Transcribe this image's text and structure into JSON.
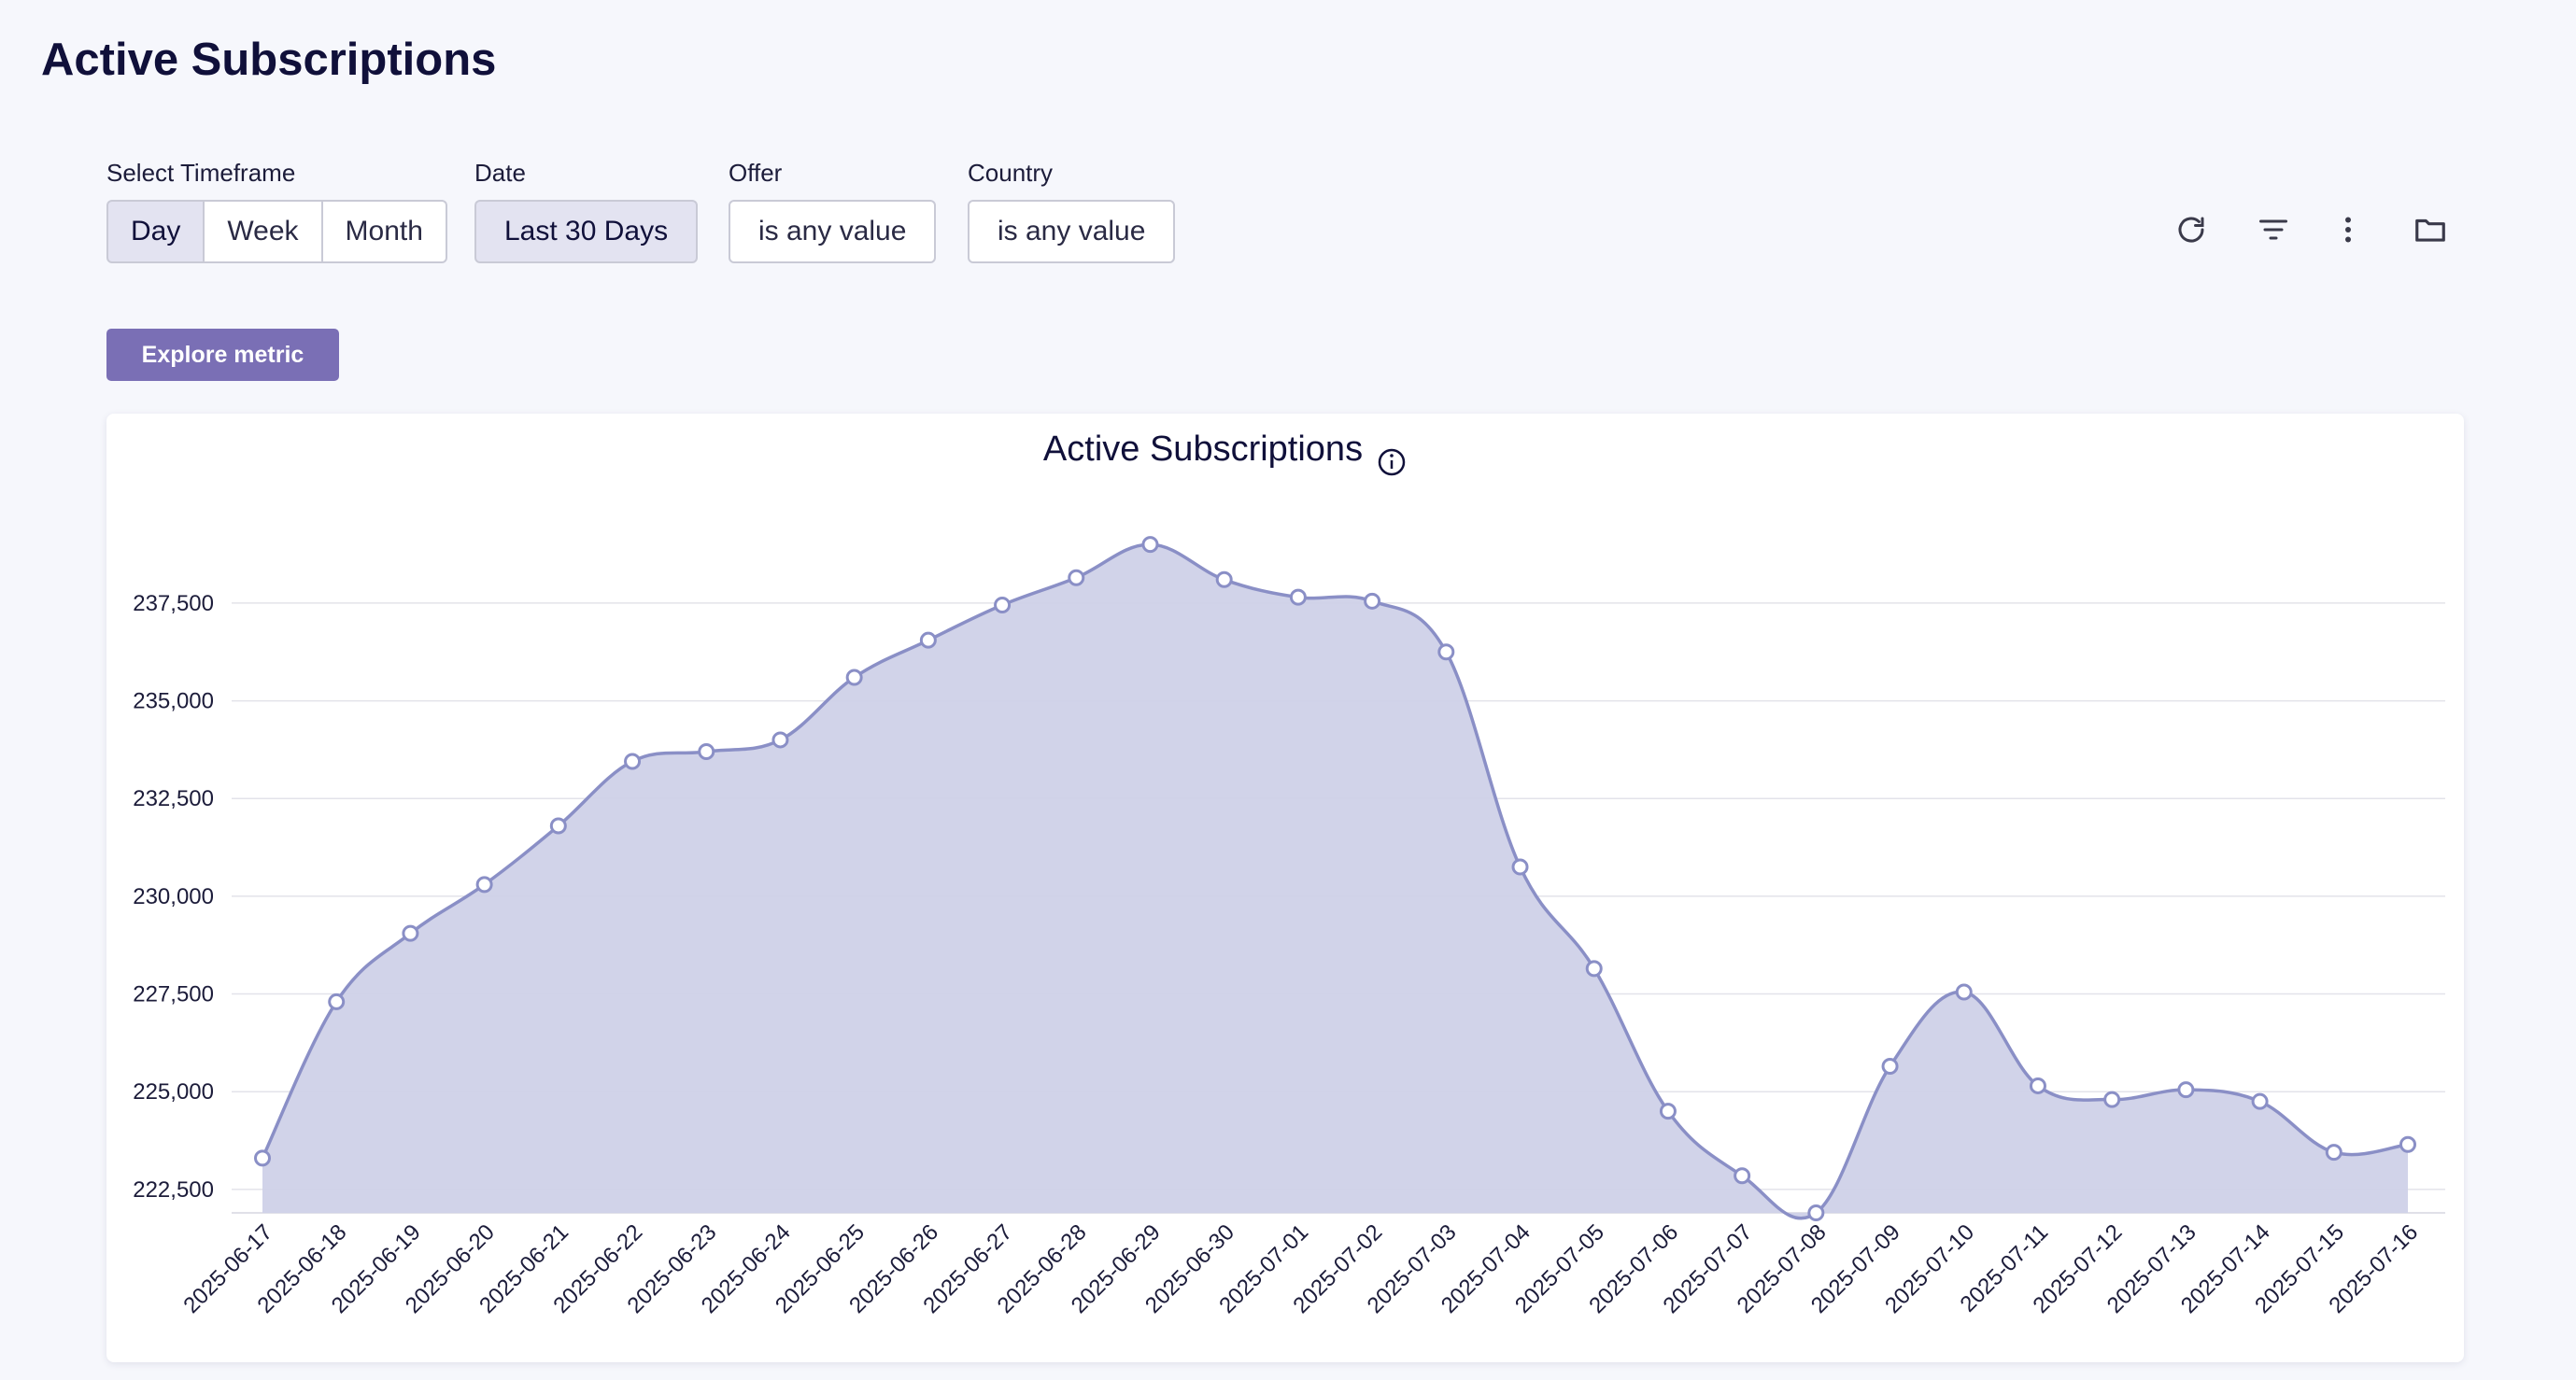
{
  "page": {
    "title": "Active Subscriptions"
  },
  "filters": {
    "timeframe": {
      "label": "Select Timeframe",
      "options": [
        "Day",
        "Week",
        "Month"
      ],
      "selected": "Day"
    },
    "date": {
      "label": "Date",
      "value": "Last 30 Days"
    },
    "offer": {
      "label": "Offer",
      "value": "is any value"
    },
    "country": {
      "label": "Country",
      "value": "is any value"
    }
  },
  "toolbar": {
    "icons": [
      "refresh-icon",
      "filter-icon",
      "more-vertical-icon",
      "folder-icon"
    ]
  },
  "explore_button": {
    "label": "Explore metric"
  },
  "colors": {
    "accent": "#7a6fb5",
    "series_line": "#8a8fc6",
    "series_fill": "#cfd1e8",
    "grid": "#e3e3ea"
  },
  "chart_data": {
    "type": "area",
    "title": "Active Subscriptions",
    "title_icon": "info-icon",
    "xlabel": "",
    "ylabel": "",
    "ylim": [
      221900,
      239600
    ],
    "yticks": [
      222500,
      225000,
      227500,
      230000,
      232500,
      235000,
      237500
    ],
    "ytick_labels": [
      "222,500",
      "225,000",
      "227,500",
      "230,000",
      "232,500",
      "235,000",
      "237,500"
    ],
    "grid": true,
    "legend": "none",
    "categories": [
      "2025-06-17",
      "2025-06-18",
      "2025-06-19",
      "2025-06-20",
      "2025-06-21",
      "2025-06-22",
      "2025-06-23",
      "2025-06-24",
      "2025-06-25",
      "2025-06-26",
      "2025-06-27",
      "2025-06-28",
      "2025-06-29",
      "2025-06-30",
      "2025-07-01",
      "2025-07-02",
      "2025-07-03",
      "2025-07-04",
      "2025-07-05",
      "2025-07-06",
      "2025-07-07",
      "2025-07-08",
      "2025-07-09",
      "2025-07-10",
      "2025-07-11",
      "2025-07-12",
      "2025-07-13",
      "2025-07-14",
      "2025-07-15",
      "2025-07-16"
    ],
    "series": [
      {
        "values": [
          223300,
          227300,
          229050,
          230300,
          231800,
          233450,
          233700,
          234000,
          235600,
          236550,
          237450,
          238150,
          239000,
          238100,
          237650,
          237550,
          236250,
          230750,
          228150,
          224500,
          222850,
          221900,
          225650,
          227550,
          225150,
          224800,
          225050,
          224750,
          223450,
          223650
        ]
      }
    ]
  }
}
